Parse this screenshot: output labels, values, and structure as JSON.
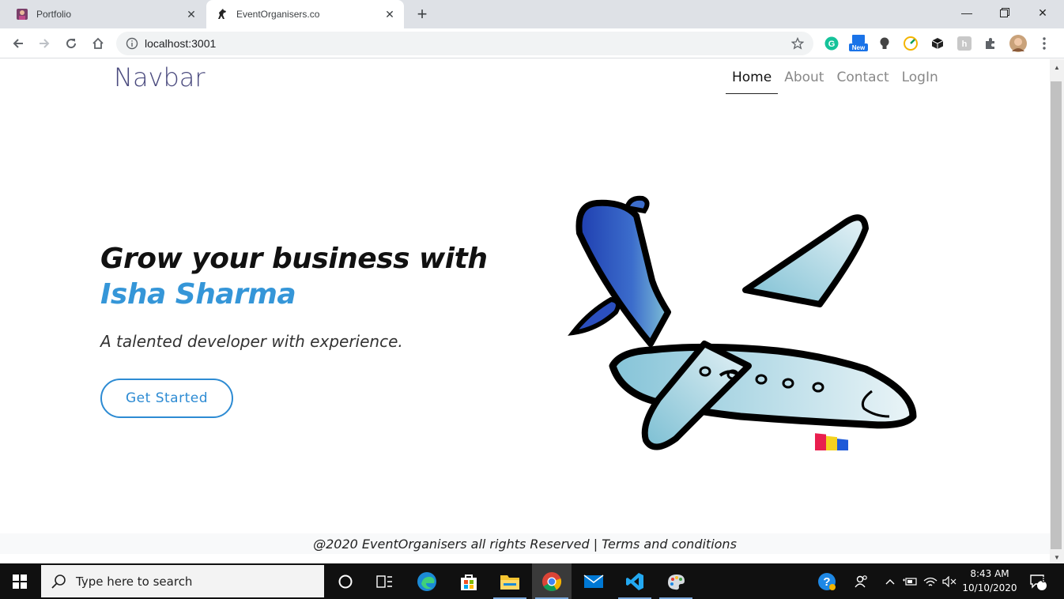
{
  "browser": {
    "tabs": [
      {
        "title": "Portfolio",
        "active": false,
        "favicon": "portfolio-avatar-icon"
      },
      {
        "title": "EventOrganisers.co",
        "active": true,
        "favicon": "horse-icon"
      }
    ],
    "url": "localhost:3001",
    "extensions": [
      "grammarly-icon",
      "new-badge-extension-icon",
      "lightbulb-icon",
      "speedometer-icon",
      "box-icon",
      "translate-icon",
      "puzzle-icon",
      "profile-avatar-icon"
    ],
    "new_badge": "New"
  },
  "navbar": {
    "brand": "Navbar",
    "links": [
      {
        "label": "Home",
        "active": true
      },
      {
        "label": "About",
        "active": false
      },
      {
        "label": "Contact",
        "active": false
      },
      {
        "label": "LogIn",
        "active": false
      }
    ]
  },
  "hero": {
    "title_prefix": "Grow your business with ",
    "title_accent": "Isha Sharma",
    "subtitle": "A talented developer with experience.",
    "cta": "Get Started"
  },
  "footer": {
    "text": "@2020 EventOrganisers all rights Reserved | Terms and conditions"
  },
  "taskbar": {
    "search_placeholder": "Type here to search",
    "apps": [
      "cortana-icon",
      "task-view-icon",
      "edge-icon",
      "store-icon",
      "file-explorer-icon",
      "chrome-icon",
      "mail-icon",
      "vscode-icon",
      "paint-icon"
    ],
    "time": "8:43 AM",
    "date": "10/10/2020",
    "notifications": "3"
  },
  "colors": {
    "accent": "#3596d8",
    "brand": "#4a4a7e",
    "button": "#2d8bd3"
  }
}
